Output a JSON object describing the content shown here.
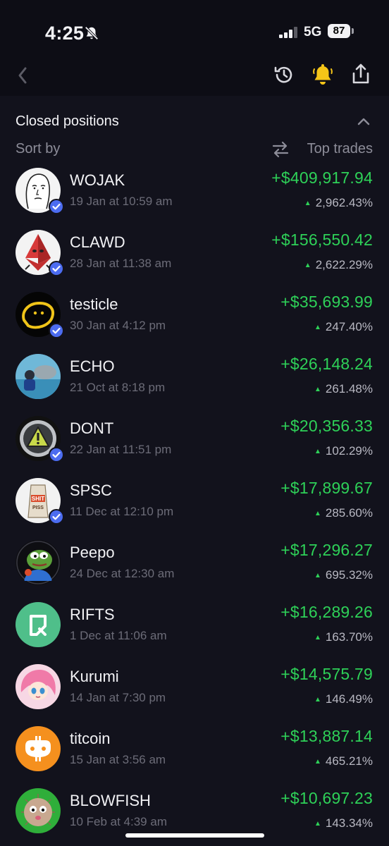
{
  "status_bar": {
    "time": "4:25",
    "network": "5G",
    "battery": "87"
  },
  "nav": {
    "back_icon": "chevron-left-icon",
    "history_icon": "history-icon",
    "bell_icon": "bell-icon",
    "share_icon": "share-icon",
    "accent": "#f5c518"
  },
  "section": {
    "title": "Closed positions",
    "sort_label": "Sort by",
    "sort_value": "Top trades"
  },
  "colors": {
    "positive": "#2ed158",
    "verified": "#4c6cf0"
  },
  "positions": [
    {
      "name": "WOJAK",
      "date": "19 Jan at 10:59 am",
      "pnl": "+$409,917.94",
      "pct": "2,962.43%",
      "verified": true,
      "avatar": "wojak-avatar"
    },
    {
      "name": "CLAWD",
      "date": "28 Jan at 11:38 am",
      "pnl": "+$156,550.42",
      "pct": "2,622.29%",
      "verified": true,
      "avatar": "clawd-avatar"
    },
    {
      "name": "testicle",
      "date": "30 Jan at 4:12 pm",
      "pnl": "+$35,693.99",
      "pct": "247.40%",
      "verified": true,
      "avatar": "testicle-avatar"
    },
    {
      "name": "ECHO",
      "date": "21 Oct at 8:18 pm",
      "pnl": "+$26,148.24",
      "pct": "261.48%",
      "verified": false,
      "avatar": "echo-avatar"
    },
    {
      "name": "DONT",
      "date": "22 Jan at 11:51 pm",
      "pnl": "+$20,356.33",
      "pct": "102.29%",
      "verified": true,
      "avatar": "dont-avatar"
    },
    {
      "name": "SPSC",
      "date": "11 Dec at 12:10 pm",
      "pnl": "+$17,899.67",
      "pct": "285.60%",
      "verified": true,
      "avatar": "spsc-avatar",
      "avatar_text": [
        "SHIT",
        "PISS"
      ]
    },
    {
      "name": "Peepo",
      "date": "24 Dec at 12:30 am",
      "pnl": "+$17,296.27",
      "pct": "695.32%",
      "verified": false,
      "avatar": "peepo-avatar"
    },
    {
      "name": "RIFTS",
      "date": "1 Dec at 11:06 am",
      "pnl": "+$16,289.26",
      "pct": "163.70%",
      "verified": false,
      "avatar": "rifts-avatar"
    },
    {
      "name": "Kurumi",
      "date": "14 Jan at 7:30 pm",
      "pnl": "+$14,575.79",
      "pct": "146.49%",
      "verified": false,
      "avatar": "kurumi-avatar"
    },
    {
      "name": "titcoin",
      "date": "15 Jan at 3:56 am",
      "pnl": "+$13,887.14",
      "pct": "465.21%",
      "verified": false,
      "avatar": "titcoin-avatar"
    },
    {
      "name": "BLOWFISH",
      "date": "10 Feb at 4:39 am",
      "pnl": "+$10,697.23",
      "pct": "143.34%",
      "verified": false,
      "avatar": "blowfish-avatar"
    }
  ]
}
